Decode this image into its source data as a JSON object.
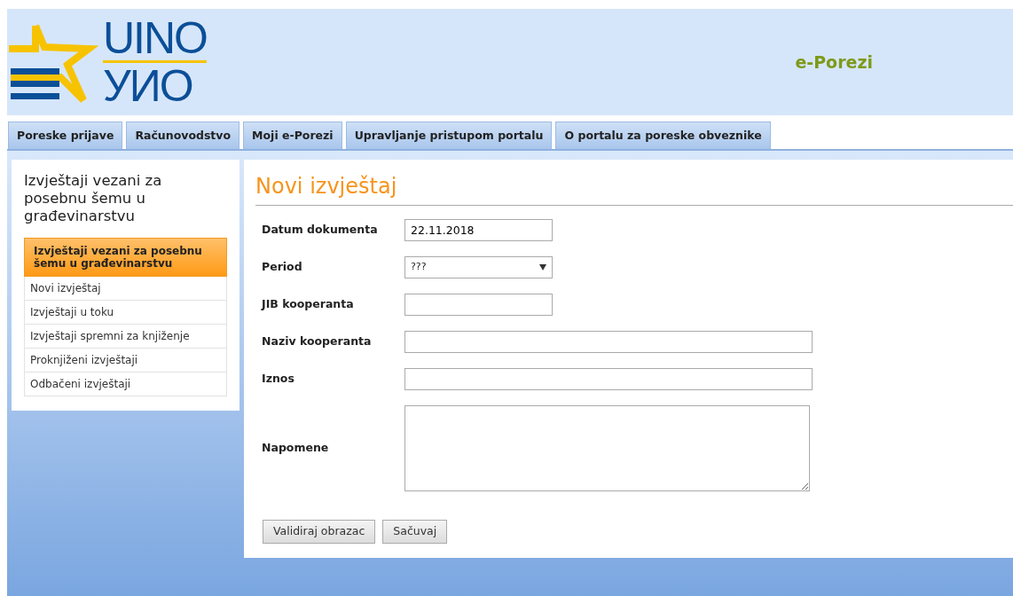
{
  "logo": {
    "line_1": "UINO",
    "line_2": "УИО"
  },
  "site_title": "e-Porezi",
  "tabs": [
    {
      "label": "Poreske prijave"
    },
    {
      "label": "Računovodstvo"
    },
    {
      "label": "Moji e-Porezi"
    },
    {
      "label": "Upravljanje pristupom portalu"
    },
    {
      "label": "O portalu za poreske obveznike"
    }
  ],
  "sidebar": {
    "title": "Izvještaji vezani za posebnu šemu u građevinarstvu",
    "section": "Izvještaji vezani za posebnu šemu u građevinarstvu",
    "items": [
      {
        "label": "Novi izvještaj"
      },
      {
        "label": "Izvještaji u toku"
      },
      {
        "label": "Izvještaji spremni za knjiženje"
      },
      {
        "label": "Proknjiženi izvještaji"
      },
      {
        "label": "Odbačeni izvještaji"
      }
    ]
  },
  "form": {
    "heading": "Novi izvještaj",
    "fields": [
      {
        "label": "Datum dokumenta",
        "kind": "short",
        "value": "22.11.2018"
      },
      {
        "label": "Period",
        "kind": "select",
        "value": "???"
      },
      {
        "label": "JIB kooperanta",
        "kind": "short"
      },
      {
        "label": "Naziv kooperanta",
        "kind": "long"
      },
      {
        "label": "Iznos",
        "kind": "long"
      },
      {
        "label": "Napomene",
        "kind": "textarea"
      }
    ],
    "buttons": [
      "Validiraj obrazac",
      "Sačuvaj"
    ]
  }
}
